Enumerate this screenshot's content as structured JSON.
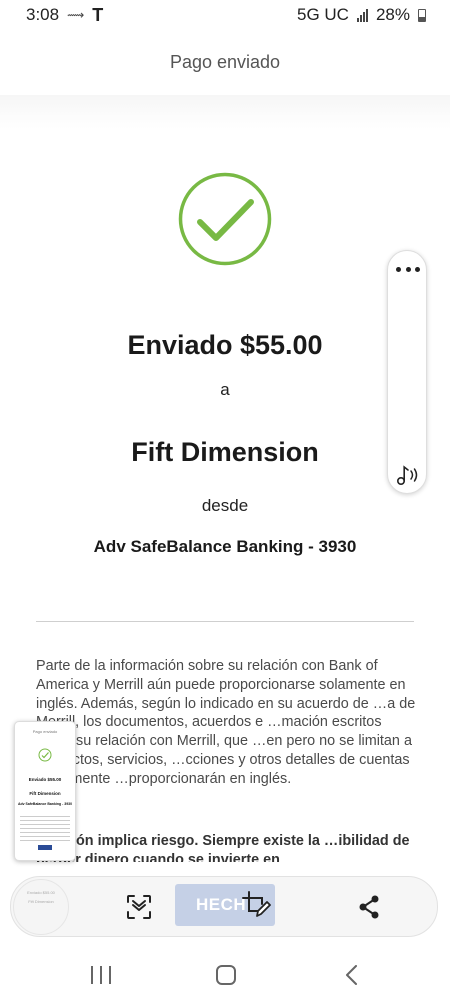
{
  "status_bar": {
    "time": "3:08",
    "network": "5G UC",
    "battery": "28%"
  },
  "header": {
    "title": "Pago enviado"
  },
  "confirmation": {
    "sent_amount": "Enviado $55.00",
    "to_word": "a",
    "recipient": "Fift Dimension",
    "from_word": "desde",
    "account": "Adv SafeBalance Banking - 3930",
    "check_color": "#78b944"
  },
  "disclosure": {
    "text": "Parte de la información sobre su relación con Bank of America y Merrill aún puede proporcionarse solamente en inglés. Además, según lo indicado en su acuerdo de …a de Merrill, los documentos, acuerdos e …mación escritos sobre su relación con Merrill, que …en pero no se limitan a productos, servicios, …cciones y otros detalles de cuentas usualmente …proporcionarán en inglés.",
    "risk_text": "…ersión implica riesgo. Siempre existe la …ibilidad de perder dinero cuando se invierte en"
  },
  "screenshot_thumbnail": {
    "title": "Pago enviado",
    "amount": "Enviado $55.00",
    "recipient": "Fift Dimension",
    "account": "Adv SafeBalance Banking - 3930"
  },
  "ghost_preview": {
    "line1": "Enviado $55.00",
    "line2": "Fift Dimension"
  },
  "toolbar": {
    "done_label": "HECH"
  },
  "icons": {
    "more": "more-horizontal-icon",
    "music": "music-note-icon",
    "scan": "smart-select-icon",
    "crop_edit": "crop-edit-icon",
    "share": "share-icon"
  }
}
